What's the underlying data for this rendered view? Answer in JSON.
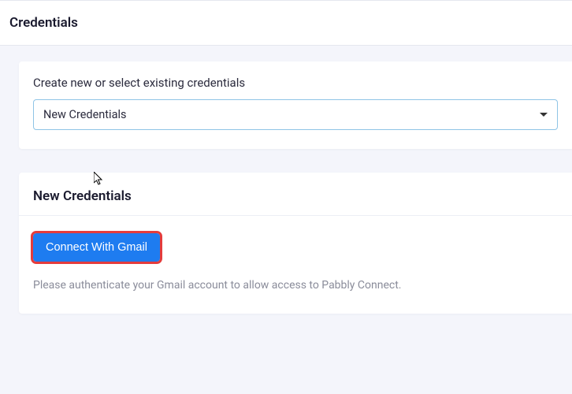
{
  "header": {
    "title": "Credentials"
  },
  "selectCard": {
    "label": "Create new or select existing credentials",
    "selected": "New Credentials"
  },
  "newCredCard": {
    "title": "New Credentials",
    "connectButton": "Connect With Gmail",
    "helpText": "Please authenticate your Gmail account to allow access to Pabbly Connect."
  }
}
